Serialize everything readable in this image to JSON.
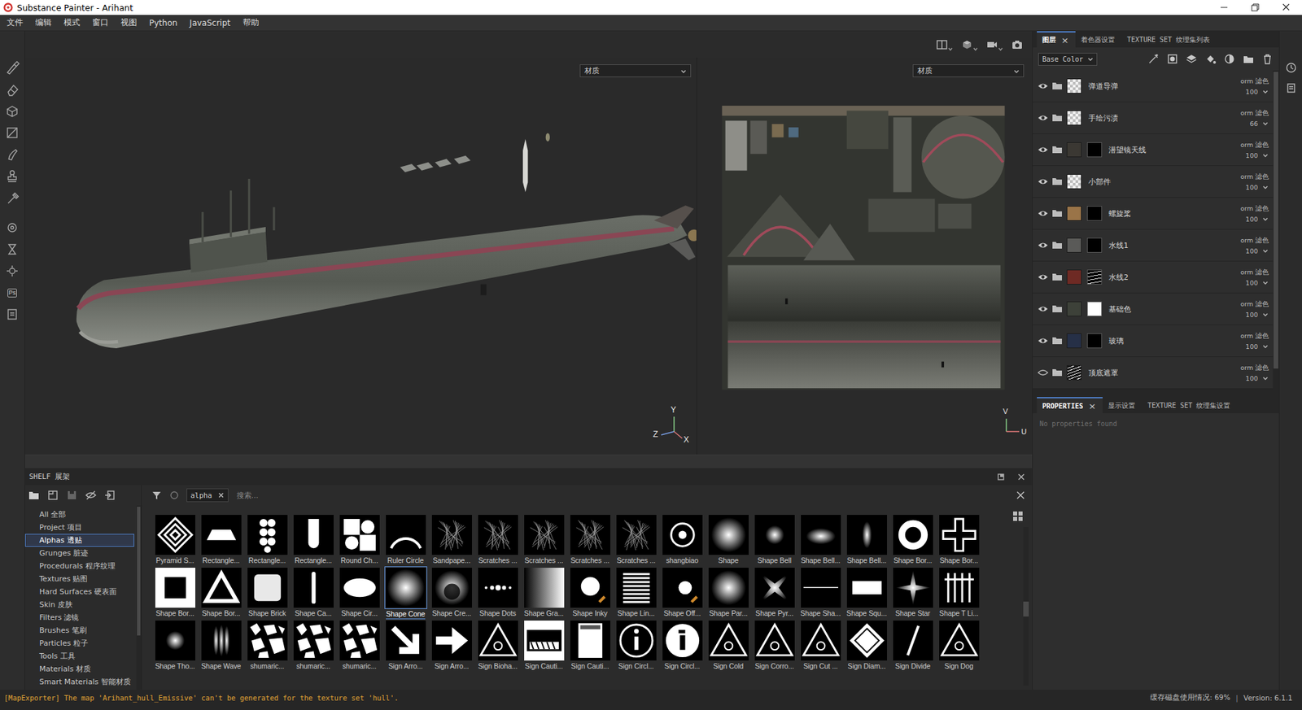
{
  "window": {
    "title": "Substance Painter - Arihant"
  },
  "menu": [
    "文件",
    "编辑",
    "模式",
    "窗口",
    "视图",
    "Python",
    "JavaScript",
    "帮助"
  ],
  "left_toolbar": {
    "ps": "Ps"
  },
  "viewport_3d": {
    "dropdown": "材质",
    "axes": [
      "Y",
      "Z",
      "X"
    ]
  },
  "viewport_2d": {
    "dropdown": "材质",
    "axes": [
      "V",
      "U"
    ]
  },
  "layers_panel": {
    "tabs": [
      {
        "label": "图层",
        "selected": true,
        "close": "×"
      },
      {
        "label": "着色器设置",
        "selected": false
      },
      {
        "label": "TEXTURE SET 纹理集列表",
        "selected": false
      }
    ],
    "channel": "Base Color",
    "layers": [
      {
        "name": "弹道导弹",
        "visible": true,
        "thumb": "checker",
        "color": "#bdbdbd",
        "mask": "none",
        "blend": "orm 滤色",
        "opacity": "100"
      },
      {
        "name": "手绘污渍",
        "visible": true,
        "thumb": "checker",
        "color": "#bdbdbd",
        "mask": "none",
        "blend": "orm 滤色",
        "opacity": "66"
      },
      {
        "name": "潜望镜天线",
        "visible": true,
        "thumb": "fill",
        "color": "#3b3833",
        "mask": "black",
        "blend": "orm 滤色",
        "opacity": "100"
      },
      {
        "name": "小部件",
        "visible": true,
        "thumb": "checker",
        "color": "#bdbdbd",
        "mask": "none",
        "blend": "orm 滤色",
        "opacity": "100"
      },
      {
        "name": "螺旋桨",
        "visible": true,
        "thumb": "fill",
        "color": "#9a7448",
        "mask": "black",
        "blend": "orm 滤色",
        "opacity": "100"
      },
      {
        "name": "水线1",
        "visible": true,
        "thumb": "fill",
        "color": "#5a5a58",
        "mask": "black",
        "blend": "orm 滤色",
        "opacity": "100"
      },
      {
        "name": "水线2",
        "visible": true,
        "thumb": "fill",
        "color": "#6e2a24",
        "mask": "pattern",
        "blend": "orm 滤色",
        "opacity": "100"
      },
      {
        "name": "基础色",
        "visible": true,
        "thumb": "fill",
        "color": "#3d4139",
        "mask": "white",
        "blend": "orm 滤色",
        "opacity": "100"
      },
      {
        "name": "玻璃",
        "visible": true,
        "thumb": "fill",
        "color": "#263047",
        "mask": "black",
        "blend": "orm 滤色",
        "opacity": "100"
      },
      {
        "name": "顶底遮罩",
        "visible": false,
        "thumb": "pattern",
        "color": "#111111",
        "mask": "none",
        "blend": "orm 滤色",
        "opacity": "100"
      }
    ]
  },
  "properties_panel": {
    "tabs": [
      {
        "label": "PROPERTIES",
        "selected": true,
        "close": "×"
      },
      {
        "label": "显示设置",
        "selected": false
      },
      {
        "label": "TEXTURE SET 纹理集设置",
        "selected": false
      }
    ],
    "empty": "No properties found"
  },
  "shelf": {
    "title": "SHELF 展架",
    "filter": "alpha",
    "search_placeholder": "搜索...",
    "categories": [
      {
        "label": "All 全部",
        "selected": false
      },
      {
        "label": "Project 项目",
        "selected": false
      },
      {
        "label": "Alphas 透贴",
        "selected": true
      },
      {
        "label": "Grunges 脏迹",
        "selected": false
      },
      {
        "label": "Procedurals 程序纹理",
        "selected": false
      },
      {
        "label": "Textures 贴图",
        "selected": false
      },
      {
        "label": "Hard Surfaces 硬表面",
        "selected": false
      },
      {
        "label": "Skin 皮肤",
        "selected": false
      },
      {
        "label": "Filters 滤镜",
        "selected": false
      },
      {
        "label": "Brushes 笔刷",
        "selected": false
      },
      {
        "label": "Particles 粒子",
        "selected": false
      },
      {
        "label": "Tools 工具",
        "selected": false
      },
      {
        "label": "Materials 材质",
        "selected": false
      },
      {
        "label": "Smart Materials 智能材质",
        "selected": false
      }
    ],
    "items": [
      {
        "label": "Pyramid S...",
        "selected": false
      },
      {
        "label": "Rectangle...",
        "selected": false
      },
      {
        "label": "Rectangle...",
        "selected": false
      },
      {
        "label": "Rectangle...",
        "selected": false
      },
      {
        "label": "Round Ch...",
        "selected": false
      },
      {
        "label": "Ruler Circle",
        "selected": false
      },
      {
        "label": "Sandpape...",
        "selected": false
      },
      {
        "label": "Scratches ...",
        "selected": false
      },
      {
        "label": "Scratches ...",
        "selected": false
      },
      {
        "label": "Scratches ...",
        "selected": false
      },
      {
        "label": "Scratches ...",
        "selected": false
      },
      {
        "label": "shangbiao",
        "selected": false
      },
      {
        "label": "Shape",
        "selected": false
      },
      {
        "label": "Shape Bell",
        "selected": false
      },
      {
        "label": "Shape Bell...",
        "selected": false
      },
      {
        "label": "Shape Bell...",
        "selected": false
      },
      {
        "label": "Shape Bor...",
        "selected": false
      },
      {
        "label": "Shape Bor...",
        "selected": false
      },
      {
        "label": "Shape Bor...",
        "selected": false
      },
      {
        "label": "Shape Bor...",
        "selected": false
      },
      {
        "label": "Shape Brick",
        "selected": false
      },
      {
        "label": "Shape Ca...",
        "selected": false
      },
      {
        "label": "Shape Cir...",
        "selected": false
      },
      {
        "label": "Shape Cone",
        "selected": true
      },
      {
        "label": "Shape Cre...",
        "selected": false
      },
      {
        "label": "Shape Dots",
        "selected": false
      },
      {
        "label": "Shape Gra...",
        "selected": false
      },
      {
        "label": "Shape Inky",
        "selected": false
      },
      {
        "label": "Shape Lin...",
        "selected": false
      },
      {
        "label": "Shape Off...",
        "selected": false
      },
      {
        "label": "Shape Par...",
        "selected": false
      },
      {
        "label": "Shape Pyr...",
        "selected": false
      },
      {
        "label": "Shape Sha...",
        "selected": false
      },
      {
        "label": "Shape Squ...",
        "selected": false
      },
      {
        "label": "Shape Star",
        "selected": false
      },
      {
        "label": "Shape T Li...",
        "selected": false
      },
      {
        "label": "Shape Tho...",
        "selected": false
      },
      {
        "label": "Shape Wave",
        "selected": false
      },
      {
        "label": "shumaric...",
        "selected": false
      },
      {
        "label": "shumaric...",
        "selected": false
      },
      {
        "label": "shumaric...",
        "selected": false
      },
      {
        "label": "Sign Arro...",
        "selected": false
      },
      {
        "label": "Sign Arro...",
        "selected": false
      },
      {
        "label": "Sign Bioha...",
        "selected": false
      },
      {
        "label": "Sign Cauti...",
        "selected": false
      },
      {
        "label": "Sign Cauti...",
        "selected": false
      },
      {
        "label": "Sign Circl...",
        "selected": false
      },
      {
        "label": "Sign Circl...",
        "selected": false
      },
      {
        "label": "Sign Cold",
        "selected": false
      },
      {
        "label": "Sign Corro...",
        "selected": false
      },
      {
        "label": "Sign Cut ...",
        "selected": false
      },
      {
        "label": "Sign Diam...",
        "selected": false
      },
      {
        "label": "Sign Divide",
        "selected": false
      },
      {
        "label": "Sign Dog",
        "selected": false
      }
    ]
  },
  "status_bar": {
    "message": "[MapExporter] The map 'Arihant_hull_Emissive' can't be generated for the texture set 'hull'.",
    "disk": "缓存磁盘使用情况: 69%",
    "separator": "|",
    "version": "Version: 6.1.1"
  }
}
